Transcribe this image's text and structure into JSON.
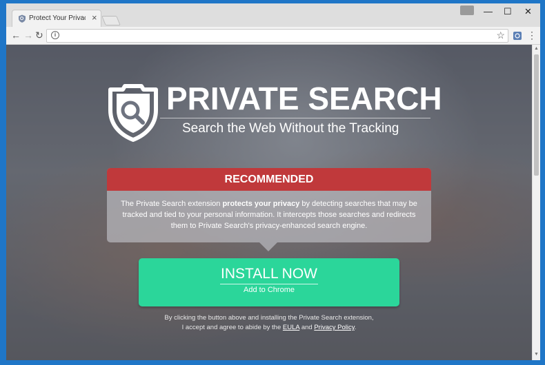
{
  "tab": {
    "title": "Protect Your Privacy with",
    "close_glyph": "×"
  },
  "window_controls": {
    "minimize": "—",
    "maximize": "☐",
    "close": "✕"
  },
  "toolbar": {
    "back": "←",
    "forward": "→",
    "reload": "↻",
    "address_value": "",
    "menu": "⋮"
  },
  "brand": {
    "title": "PRIVATE SEARCH",
    "tagline": "Search the Web Without the Tracking"
  },
  "recommended": {
    "header": "RECOMMENDED",
    "text_part1": "The Private Search extension ",
    "text_bold": "protects your privacy",
    "text_part2": " by detecting searches that may be tracked and tied to your personal information. It intercepts those searches and redirects them to Private Search's privacy-enhanced search engine."
  },
  "install": {
    "main_label": "INSTALL NOW",
    "sub_label": "Add to Chrome"
  },
  "legal": {
    "line1": "By clicking the button above and installing the Private Search extension,",
    "line2_prefix": "I accept and agree to abide by the ",
    "eula": "EULA",
    "and": " and ",
    "privacy": "Privacy Policy",
    "suffix": "."
  },
  "colors": {
    "accent_red": "#c0393b",
    "install_green": "#2bd69a",
    "window_border": "#1f76c7"
  }
}
